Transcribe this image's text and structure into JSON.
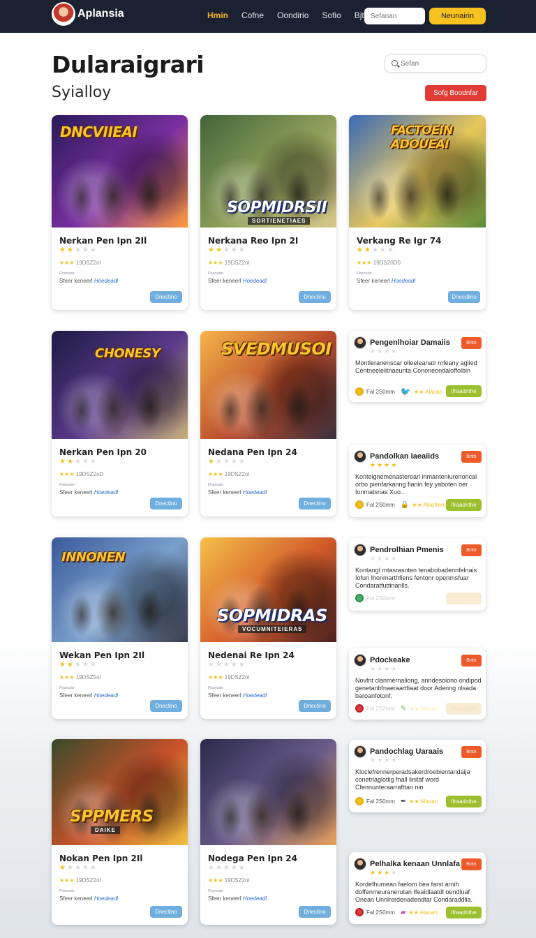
{
  "nav": {
    "brand": "Aplansia",
    "links": [
      "Hmin",
      "Cofne",
      "Oondirio",
      "Sofio",
      "Bjties"
    ],
    "search_placeholder": "Sefanan",
    "cta": "Neunairin"
  },
  "header": {
    "title": "Dularaigrari",
    "subtitle": "Syialloy",
    "search_placeholder": "Sefan",
    "red_button": "Sofg Boodnfar"
  },
  "colors": {
    "navbar": "#1a2130",
    "nav_active": "#f5b820",
    "cta": "#f7c21f",
    "red_button": "#e23b35",
    "play_button": "#6faede",
    "review_tag": "#ee5a2a",
    "review_button": "#9bbf2d",
    "star": "#f2c118"
  },
  "games": [
    {
      "banner": "DNCVIIEAI",
      "subbanner": "",
      "title": "Nerkan Pen Ipn 2Il",
      "stars": 2,
      "rating": "19DSZ2ol",
      "tiny": "Fhanudo",
      "meta": "Sfeer keneerl",
      "meta_link": "Hoedeadl",
      "button": "Dnectino"
    },
    {
      "banner": "SOPMIDRSII",
      "subbanner": "SORTIENETIAES",
      "title": "Nerkana Reo Ipn 2I",
      "stars": 2,
      "rating": "19DSZ2ol",
      "tiny": "Fhanudo",
      "meta": "Sfeer keneerl",
      "meta_link": "Hoedeadl",
      "button": "Dnectinu"
    },
    {
      "banner": "FACTOEIN ADOUEAI",
      "subbanner": "",
      "title": "Verkang Re Igr 74",
      "stars": 2,
      "rating": "19DS20D0",
      "tiny": "Fhanudo",
      "meta": "Sfeer keneerl",
      "meta_link": "Hoedeadl",
      "button": "Dnecdlino"
    },
    {
      "banner": "CHONESY",
      "subbanner": "",
      "title": "Nerkan Pen Ipn 20",
      "stars": 2,
      "rating": "19DSZ2oD",
      "tiny": "Fhanudo",
      "meta": "Sfeer keneerl",
      "meta_link": "Hoedeadl",
      "button": "Dnectino"
    },
    {
      "banner": "SVEDMUSOI",
      "subbanner": "",
      "title": "Nedana Pen Ipn 24",
      "stars": 1,
      "rating": "19DSZ2ol",
      "tiny": "Fhanudo",
      "meta": "Sfeer keneerl",
      "meta_link": "Hoedeadl",
      "button": "Dnectino"
    },
    {
      "banner": "INNONEN",
      "subbanner": "",
      "title": "Wekan Pen Ipn 2Il",
      "stars": 2,
      "rating": "19DSZ5ol",
      "tiny": "Fhanudo",
      "meta": "Sfeer keneerl",
      "meta_link": "Hoedeadl",
      "button": "Dnectino"
    },
    {
      "banner": "SOPMIDRAS",
      "subbanner": "VOCUMNITEIERAS",
      "title": "Nedenai Re Ipn 24",
      "stars": 0,
      "rating": "19DSZ2ol",
      "tiny": "Fhanudo",
      "meta": "Sfeer keneerl",
      "meta_link": "Hoedeadl",
      "button": "Dnectino"
    },
    {
      "banner": "SPPMERS",
      "subbanner": "DAIKE",
      "title": "Nokan Pen Ipn 2Il",
      "stars": 1,
      "rating": "19DSZ2ol",
      "tiny": "Fhanudo",
      "meta": "Sfeer keneerl",
      "meta_link": "Hoedeadl",
      "button": "Dnectino"
    },
    {
      "banner": "",
      "subbanner": "",
      "title": "Nodega Pen Ipn 24",
      "stars": 0,
      "rating": "19DSZ2ol",
      "tiny": "Fhanudo",
      "meta": "Sfeer keneerl",
      "meta_link": "Hoedeadl",
      "button": "Dnectino"
    }
  ],
  "reviews": [
    {
      "name": "Pengenlhoiar Damaiis",
      "tag": "Bntn",
      "stars": 0,
      "body": "Montleranenscar olleeleanatr mfeany aglied Centneeleiitnaeunta Cononeondaloffolbin",
      "price": "Fal 2S0mm",
      "icon": "twitter-bird-icon",
      "rating_small": "★★ Alaoan",
      "button": "Ifraadnthe",
      "faded": false
    },
    {
      "name": "Pandolkan Iaeaiids",
      "tag": "Bntn",
      "stars": 4,
      "body": "Kontelgnemenasterearl inmanteniurenorical orbo pienfarkanng fianin fey yaboten oer Ionmatsnas Xuo..",
      "price": "Fal 2S0mm",
      "icon": "lock-icon",
      "rating_small": "★★ Alaofrem",
      "button": "Ifraadnthe",
      "faded": false
    },
    {
      "name": "Pendrolhian Pmenis",
      "tag": "Bntn",
      "stars": 0,
      "body": "Kontangl rntasrasnten tenabobadennfelnais Iofun Ihonmarthfiens fentonr openmsfuar Condaratfuttinanlls.",
      "price": "Fal 2S0mm",
      "icon": "",
      "rating_small": "",
      "button": "",
      "faded": true
    },
    {
      "name": "Pdockeake",
      "tag": "Bntn",
      "stars": 0,
      "body": "Novfnt clanmernaliong, anndesoiono ondipod genetanbfnaeraartfiaat door Adenng nlsada baroanfotonf.",
      "price": "Fal 2S2mm",
      "icon": "pencil-icon",
      "rating_small": "★★ Alaoan",
      "button": "Ifraadnthe",
      "faded": true
    },
    {
      "name": "Pandochlag Uaraais",
      "tag": "Bntn",
      "stars": 0,
      "body": "Kloclefrennerperadsakerdroebientandaija conetriaglotlig fnall linitaf word Cfennunteraarrafttan nin",
      "price": "Fal 2S0mm",
      "icon": "pen-icon",
      "rating_small": "★★ Alaoan",
      "button": "Ifraadnthe",
      "faded": false
    },
    {
      "name": "Pelhalka kenaan Unnlafa",
      "tag": "Bntn",
      "stars": 3,
      "body": "Kordefhumean faelom bea farst arnih doffenmeuranerutan Ifeaidlaatdl oendluaf Onean Unnlrerdenadendtar Condaraddlia.",
      "price": "Fal 2S0mm",
      "icon": "eraser-icon",
      "rating_small": "★★ Alaoan",
      "button": "Ifraadnthe",
      "faded": false
    }
  ]
}
